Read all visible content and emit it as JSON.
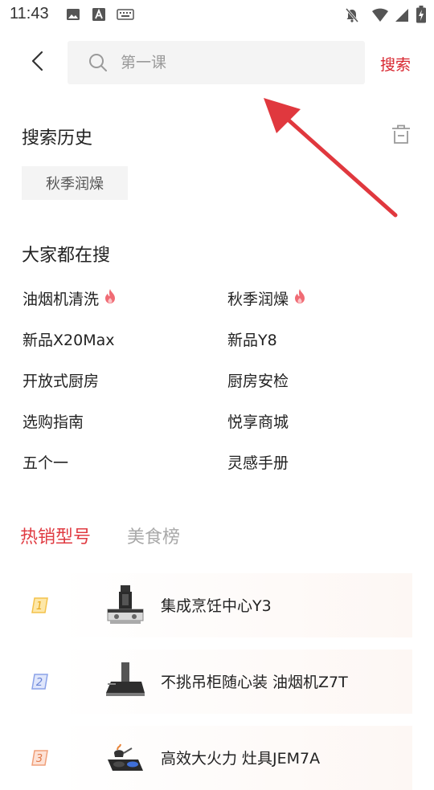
{
  "status_bar": {
    "time": "11:43",
    "left_icons": [
      "image-icon",
      "text-a-icon",
      "keyboard-icon"
    ],
    "right_icons": [
      "mute-bell-icon",
      "wifi-icon",
      "signal-icon",
      "battery-icon"
    ]
  },
  "header": {
    "back_icon": "back-arrow-icon",
    "search_icon": "search-icon",
    "search_placeholder": "第一课",
    "search_value": "",
    "search_button": "搜索"
  },
  "history": {
    "title": "搜索历史",
    "clear_icon": "trash-icon",
    "chips": [
      "秋季润燥"
    ]
  },
  "trending": {
    "title": "大家都在搜",
    "items": [
      {
        "label": "油烟机清洗",
        "hot": true
      },
      {
        "label": "秋季润燥",
        "hot": true
      },
      {
        "label": "新品X20Max",
        "hot": false
      },
      {
        "label": "新品Y8",
        "hot": false
      },
      {
        "label": "开放式厨房",
        "hot": false
      },
      {
        "label": "厨房安检",
        "hot": false
      },
      {
        "label": "选购指南",
        "hot": false
      },
      {
        "label": "悦享商城",
        "hot": false
      },
      {
        "label": "五个一",
        "hot": false
      },
      {
        "label": "灵感手册",
        "hot": false
      }
    ]
  },
  "tabs": [
    {
      "label": "热销型号",
      "active": true
    },
    {
      "label": "美食榜",
      "active": false
    }
  ],
  "ranking": [
    {
      "rank": 1,
      "name": "集成烹饪中心Y3",
      "badge_color": "#f4c24b",
      "thumb": "integrated-stove-icon"
    },
    {
      "rank": 2,
      "name": "不挑吊柜随心装 油烟机Z7T",
      "badge_color": "#8aa2e8",
      "thumb": "range-hood-icon"
    },
    {
      "rank": 3,
      "name": "高效大火力 灶具JEM7A",
      "badge_color": "#f0a07a",
      "thumb": "gas-cooktop-icon"
    }
  ],
  "colors": {
    "accent_red": "#e03b42",
    "search_red": "#d8262f",
    "annotation_arrow": "#e0383e",
    "chip_bg": "#f4f4f4"
  }
}
